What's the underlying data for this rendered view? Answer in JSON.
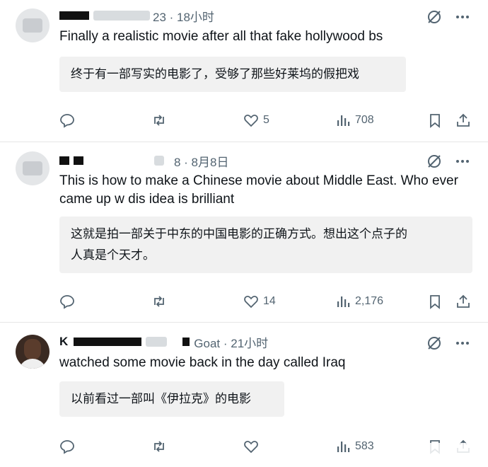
{
  "posts": [
    {
      "meta": "23 · 18小时",
      "text": "Finally a realistic movie after all that fake hollywood bs",
      "translation": "终于有一部写实的电影了，受够了那些好莱坞的假把戏",
      "likes": "5",
      "views": "708"
    },
    {
      "meta": "8 · 8月8日",
      "text": "This is how to make a Chinese movie about Middle East. Who ever came up w dis idea is brilliant",
      "translation_line1": "这就是拍一部关于中东的中国电影的正确方式。想出这个点子的",
      "translation_line2": "人真是个天才。",
      "likes": "14",
      "views": "2,176"
    },
    {
      "name_visible": "K",
      "meta": "Goat · 21小时",
      "text": "watched some movie back in the day called Iraq",
      "translation": "以前看过一部叫《伊拉克》的电影",
      "likes": "",
      "views": "583"
    }
  ],
  "icons": [
    "grok-icon",
    "more-icon",
    "reply-icon",
    "retweet-icon",
    "like-icon",
    "views-icon",
    "bookmark-icon",
    "share-icon"
  ],
  "colors": {
    "text": "#0f1419",
    "muted": "#536471",
    "translation_bg": "#f1f1f1"
  }
}
